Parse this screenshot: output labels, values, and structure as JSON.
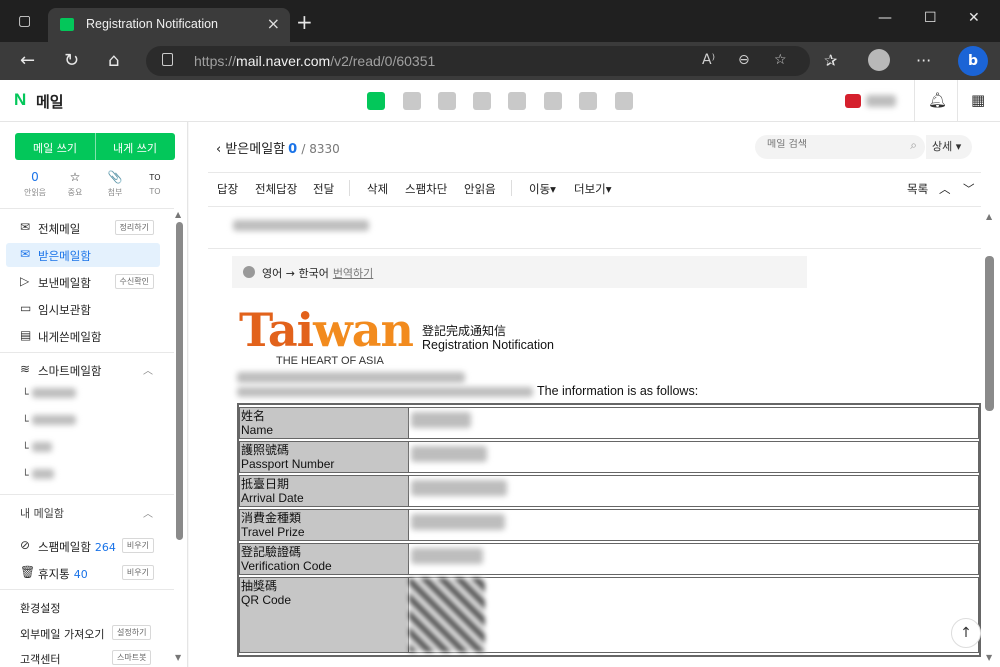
{
  "browser": {
    "tab_title": "Registration Notification",
    "url_prefix": "https://",
    "url_host": "mail.naver.com",
    "url_path": "/v2/read/0/60351",
    "bing_label": "b"
  },
  "app": {
    "logo_n": "N",
    "logo_text": "메일"
  },
  "sidebar": {
    "compose": "메일 쓰기",
    "compose_self": "내게 쓰기",
    "quick": [
      {
        "value": "0",
        "label": "안읽음"
      },
      {
        "value": "☆",
        "label": "중요"
      },
      {
        "value": "📎",
        "label": "첨부"
      },
      {
        "value": "TO",
        "label": "TO"
      }
    ],
    "folders": [
      {
        "label": "전체메일",
        "button": "정리하기"
      },
      {
        "label": "받은메일함",
        "button": ""
      },
      {
        "label": "보낸메일함",
        "button": "수신확인"
      },
      {
        "label": "임시보관함",
        "button": ""
      },
      {
        "label": "내게쓴메일함",
        "button": ""
      }
    ],
    "smart_mailbox": "스마트메일함",
    "my_mailbox": "내 메일함",
    "spam": {
      "label": "스팸메일함",
      "count": "264",
      "button": "비우기"
    },
    "trash": {
      "label": "휴지통",
      "count": "40",
      "button": "비우기"
    },
    "settings": "환경설정",
    "external": {
      "label": "외부메일 가져오기",
      "button": "설정하기"
    },
    "support": {
      "label": "고객센터",
      "button": "스마트봇"
    }
  },
  "main": {
    "mailbox_title": "받은메일함",
    "unread": "0",
    "total": "/ 8330",
    "search_placeholder": "메일 검색",
    "detail": "상세 ▾",
    "toolbar": {
      "reply": "답장",
      "reply_all": "전체답장",
      "forward": "전달",
      "delete": "삭제",
      "spam_block": "스팸차단",
      "mark_unread": "안읽음",
      "move": "이동",
      "more": "더보기",
      "list": "목록"
    },
    "translate": {
      "from_to": "영어 → 한국어",
      "link": "번역하기"
    }
  },
  "email": {
    "logo_word_1": "Tai",
    "logo_word_2": "wan",
    "logo_tagline": "THE HEART OF ASIA",
    "heading_zh": "登記完成通知信",
    "heading_en": "Registration Notification",
    "intro_tail": "The information is as follows:",
    "rows": [
      {
        "zh": "姓名",
        "en": "Name"
      },
      {
        "zh": "護照號碼",
        "en": "Passport Number"
      },
      {
        "zh": "抵臺日期",
        "en": "Arrival Date"
      },
      {
        "zh": "消費金種類",
        "en": "Travel Prize"
      },
      {
        "zh": "登記驗證碼",
        "en": "Verification Code"
      },
      {
        "zh": "抽獎碼",
        "en": "QR Code"
      }
    ]
  },
  "colors": {
    "brand": "#03c75a",
    "accent": "#1a73e8"
  }
}
